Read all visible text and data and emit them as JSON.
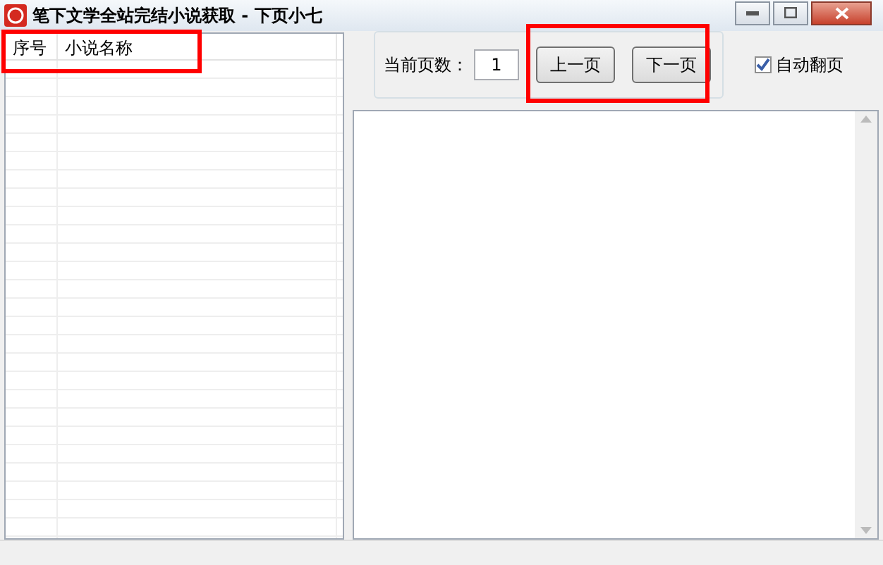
{
  "window": {
    "title": "笔下文学全站完结小说获取 - 下页小七"
  },
  "table": {
    "columns": [
      "序号",
      "小说名称"
    ]
  },
  "pager": {
    "label": "当前页数：",
    "page": "1",
    "buttons": [
      "上一页",
      "下一页"
    ]
  },
  "auto_page": {
    "label": "自动翻页",
    "checked": true
  }
}
